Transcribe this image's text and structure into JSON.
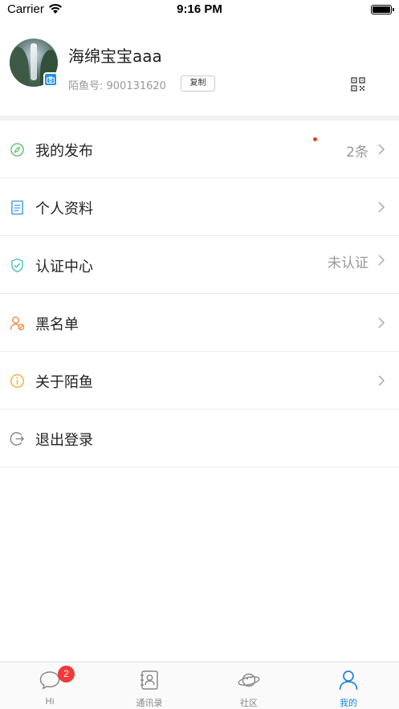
{
  "status_bar": {
    "carrier": "Carrier",
    "time": "9:16 PM"
  },
  "profile": {
    "nickname": "海绵宝宝aaa",
    "user_id": "陌鱼号: 900131620",
    "copy_label": "复制"
  },
  "menu": {
    "items": [
      {
        "label": "我的发布",
        "value": "2条",
        "icon": "compass-icon",
        "icon_color": "#5cc46a"
      },
      {
        "label": "个人资料",
        "value": "",
        "icon": "document-icon",
        "icon_color": "#3d9be9"
      },
      {
        "label": "认证中心",
        "value": "未认证",
        "icon": "shield-check-icon",
        "icon_color": "#4fc3c3"
      },
      {
        "label": "黑名单",
        "value": "",
        "icon": "user-block-icon",
        "icon_color": "#f08a4b"
      },
      {
        "label": "关于陌鱼",
        "value": "",
        "icon": "info-icon",
        "icon_color": "#f2b233"
      },
      {
        "label": "退出登录",
        "value": "",
        "icon": "logout-icon",
        "icon_color": "#888888"
      }
    ]
  },
  "tabbar": {
    "tabs": [
      {
        "label": "Hi",
        "icon": "chat-bubble-icon",
        "badge": "2"
      },
      {
        "label": "通讯录",
        "icon": "contacts-book-icon"
      },
      {
        "label": "社区",
        "icon": "planet-icon"
      },
      {
        "label": "我的",
        "icon": "person-icon",
        "active": true
      }
    ]
  },
  "colors": {
    "accent": "#1e84e0",
    "badge": "#f03a3a",
    "divider": "#f0f0f0"
  }
}
